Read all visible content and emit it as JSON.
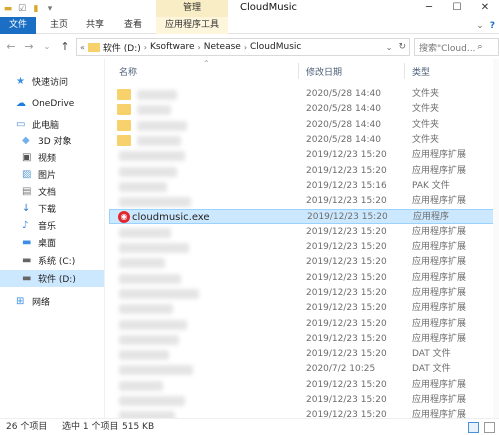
{
  "window": {
    "title": "CloudMusic",
    "context_tab_group": "管理",
    "controls": {
      "minimize": "─",
      "maximize": "☐",
      "close": "✕"
    }
  },
  "ribbon": {
    "tabs": [
      "文件",
      "主页",
      "共享",
      "查看"
    ],
    "context_tab": "应用程序工具"
  },
  "address": {
    "breadcrumbs": [
      "软件 (D:)",
      "Ksoftware",
      "Netease",
      "CloudMusic"
    ],
    "search_placeholder": "搜索\"Cloud..."
  },
  "sidebar": {
    "items": [
      {
        "label": "快速访问",
        "icon": "star-icon"
      },
      {
        "label": "OneDrive",
        "icon": "cloud-icon"
      },
      {
        "label": "此电脑",
        "icon": "computer-icon"
      },
      {
        "label": "3D 对象",
        "icon": "cube-icon"
      },
      {
        "label": "视频",
        "icon": "video-icon"
      },
      {
        "label": "图片",
        "icon": "picture-icon"
      },
      {
        "label": "文档",
        "icon": "document-icon"
      },
      {
        "label": "下载",
        "icon": "download-icon"
      },
      {
        "label": "音乐",
        "icon": "music-icon"
      },
      {
        "label": "桌面",
        "icon": "desktop-icon"
      },
      {
        "label": "系统 (C:)",
        "icon": "drive-icon"
      },
      {
        "label": "软件 (D:)",
        "icon": "drive-icon"
      },
      {
        "label": "网络",
        "icon": "network-icon"
      }
    ]
  },
  "columns": {
    "name": "名称",
    "date": "修改日期",
    "type": "类型"
  },
  "files": [
    {
      "date": "2020/5/28 14:40",
      "type": "文件夹",
      "folder": true
    },
    {
      "date": "2020/5/28 14:40",
      "type": "文件夹",
      "folder": true
    },
    {
      "date": "2020/5/28 14:40",
      "type": "文件夹",
      "folder": true
    },
    {
      "date": "2020/5/28 14:40",
      "type": "文件夹",
      "folder": true
    },
    {
      "date": "2019/12/23 15:20",
      "type": "应用程序扩展"
    },
    {
      "date": "2019/12/23 15:20",
      "type": "应用程序扩展"
    },
    {
      "date": "2019/12/23 15:16",
      "type": "PAK 文件"
    },
    {
      "date": "2019/12/23 15:20",
      "type": "应用程序扩展"
    },
    {
      "name": "cloudmusic.exe",
      "date": "2019/12/23 15:20",
      "type": "应用程序",
      "selected": true
    },
    {
      "date": "2019/12/23 15:20",
      "type": "应用程序扩展"
    },
    {
      "date": "2019/12/23 15:20",
      "type": "应用程序扩展"
    },
    {
      "date": "2019/12/23 15:20",
      "type": "应用程序扩展"
    },
    {
      "date": "2019/12/23 15:20",
      "type": "应用程序扩展"
    },
    {
      "date": "2019/12/23 15:20",
      "type": "应用程序扩展"
    },
    {
      "date": "2019/12/23 15:20",
      "type": "应用程序扩展"
    },
    {
      "date": "2019/12/23 15:20",
      "type": "应用程序扩展"
    },
    {
      "date": "2019/12/23 15:20",
      "type": "应用程序扩展"
    },
    {
      "date": "2019/12/23 15:20",
      "type": "DAT 文件"
    },
    {
      "date": "2020/7/2 10:25",
      "type": "DAT 文件"
    },
    {
      "date": "2019/12/23 15:20",
      "type": "应用程序扩展"
    },
    {
      "date": "2019/12/23 15:20",
      "type": "应用程序扩展"
    },
    {
      "date": "2019/12/23 15:20",
      "type": "应用程序扩展"
    }
  ],
  "status": {
    "count": "26 个项目",
    "selection": "选中 1 个项目",
    "size": "515 KB"
  },
  "colors": {
    "accent": "#1a6fc5",
    "selection": "#cce8ff",
    "context": "#f8edc4"
  }
}
